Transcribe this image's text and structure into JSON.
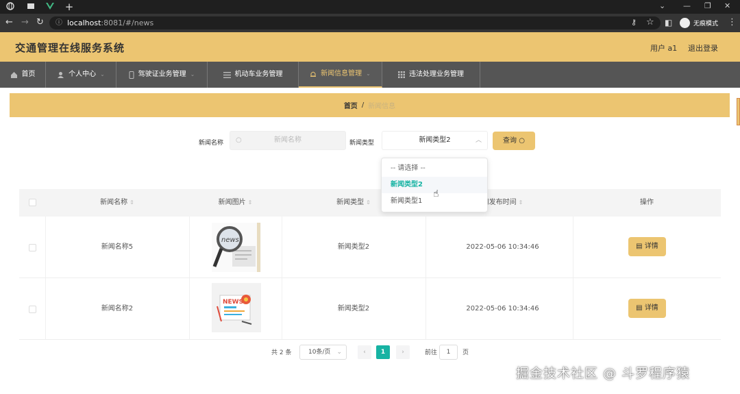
{
  "browser": {
    "url_host": "localhost",
    "url_rest": ":8081/#/news",
    "incognito_label": "无痕模式",
    "tab_icons": [
      "globe-icon",
      "window-icon",
      "vue-logo-icon"
    ]
  },
  "header": {
    "title": "交通管理在线服务系统",
    "user_label": "用户 a1",
    "logout": "退出登录"
  },
  "nav": {
    "items": [
      {
        "label": "首页",
        "icon": "home-icon"
      },
      {
        "label": "个人中心",
        "icon": "user-icon"
      },
      {
        "label": "驾驶证业务管理",
        "icon": "phone-icon"
      },
      {
        "label": "机动车业务管理",
        "icon": "list-icon"
      },
      {
        "label": "新闻信息管理",
        "icon": "bell-icon"
      },
      {
        "label": "违法处理业务管理",
        "icon": "grid-icon"
      }
    ],
    "active_index": 4
  },
  "breadcrumb": {
    "home": "首页",
    "sep": "/",
    "current": "新闻信息"
  },
  "search": {
    "name_label": "新闻名称",
    "name_placeholder": "新闻名称",
    "type_label": "新闻类型",
    "type_value": "新闻类型2",
    "query_button": "查询"
  },
  "dropdown": {
    "options": [
      "-- 请选择 --",
      "新闻类型2",
      "新闻类型1"
    ],
    "selected_index": 1
  },
  "table": {
    "columns": [
      "新闻名称",
      "新闻图片",
      "新闻类型",
      "新闻发布时间",
      "操作"
    ],
    "rows": [
      {
        "name": "新闻名称5",
        "type": "新闻类型2",
        "time": "2022-05-06 10:34:46",
        "action": "详情"
      },
      {
        "name": "新闻名称2",
        "type": "新闻类型2",
        "time": "2022-05-06 10:34:46",
        "action": "详情"
      }
    ]
  },
  "pager": {
    "total": "共 2 条",
    "size": "10条/页",
    "prev": "‹",
    "page": "1",
    "next": "›",
    "goto_label": "前往",
    "goto_value": "1",
    "goto_suffix": "页"
  },
  "watermark": "掘金技术社区 @ 斗罗程序猿",
  "colors": {
    "accent": "#ecc571",
    "nav": "#555555",
    "active_page": "#17b3a3"
  }
}
